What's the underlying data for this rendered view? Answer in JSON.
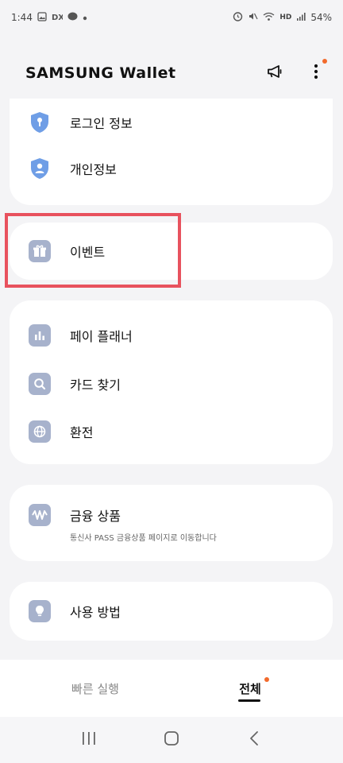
{
  "status_bar": {
    "time": "1:44",
    "battery": "54%",
    "network": "HD"
  },
  "header": {
    "title": "SAMSUNG Wallet"
  },
  "sections": {
    "security": {
      "items": [
        {
          "label": "로그인 정보"
        },
        {
          "label": "개인정보"
        }
      ]
    },
    "event": {
      "label": "이벤트"
    },
    "services": {
      "items": [
        {
          "label": "페이 플래너"
        },
        {
          "label": "카드 찾기"
        },
        {
          "label": "환전"
        }
      ]
    },
    "finance": {
      "label": "금융 상품",
      "sub": "통신사 PASS 금융상품 페이지로 이동합니다"
    },
    "help": {
      "label": "사용 방법"
    }
  },
  "bottom_tabs": {
    "quick": "빠른 실행",
    "all": "전체"
  },
  "colors": {
    "accent_orange": "#f26a2c",
    "highlight_red": "#e8525e",
    "icon_gray_blue": "#a7b2cc",
    "shield_blue": "#6f9ee6"
  }
}
